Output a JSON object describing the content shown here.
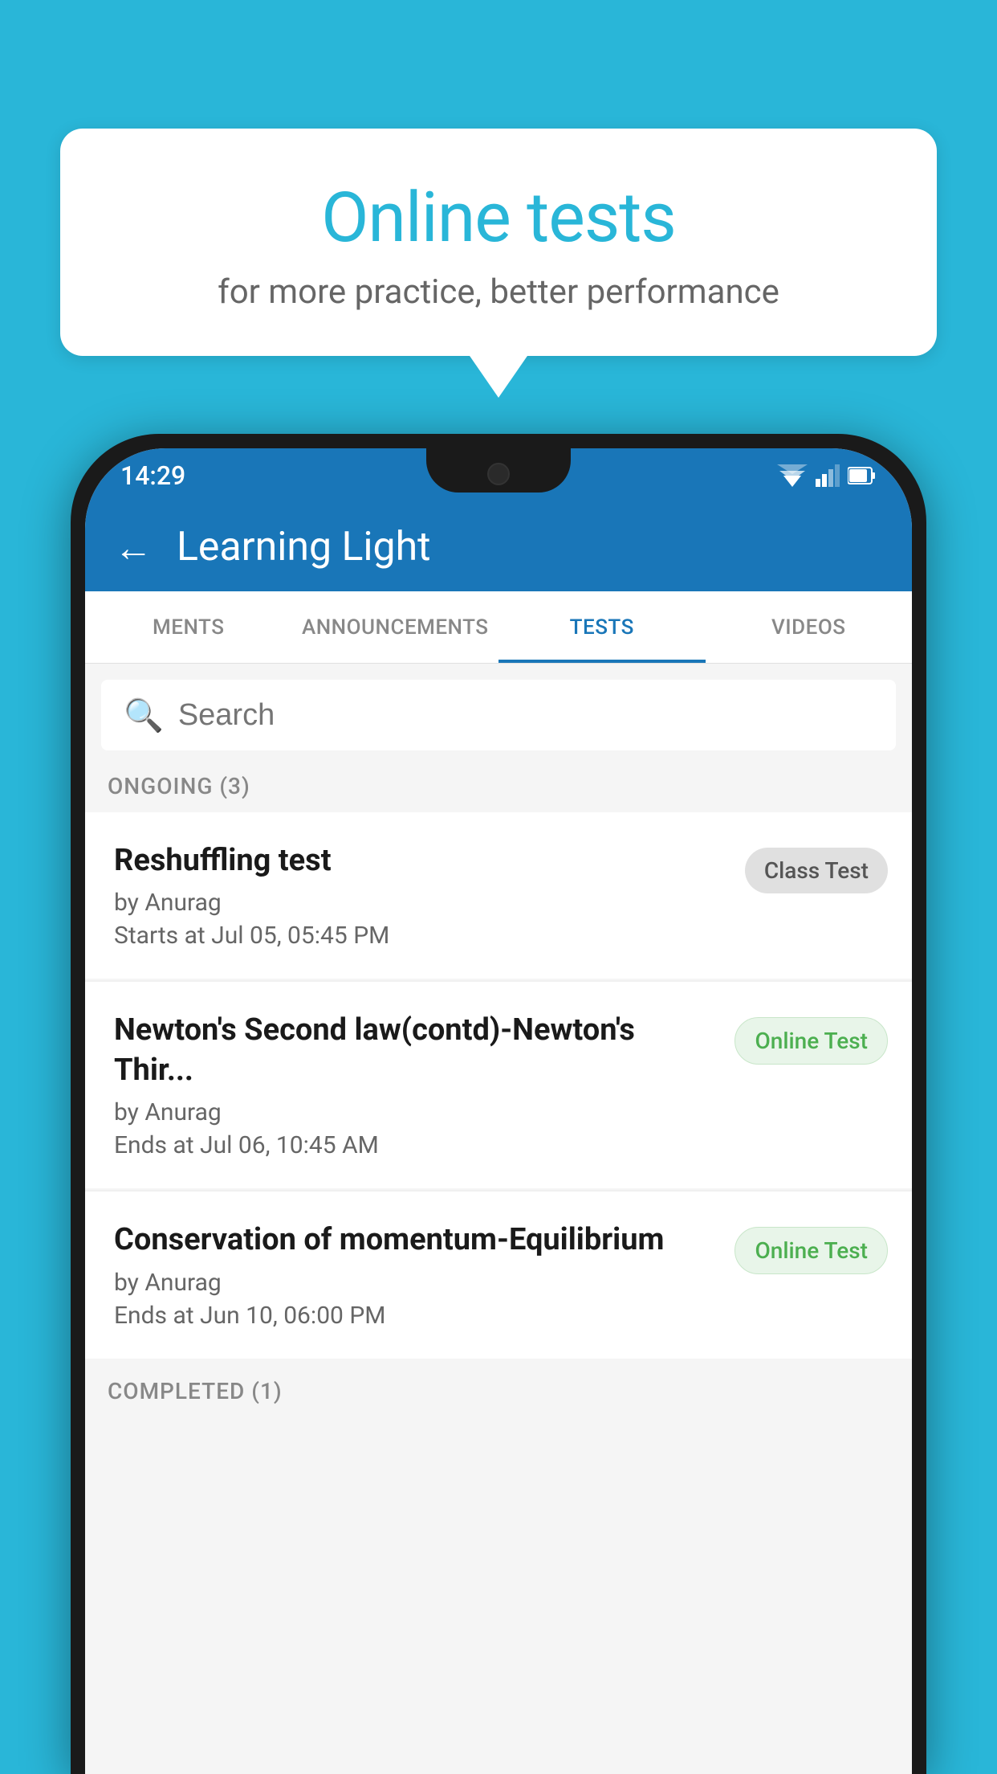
{
  "background_color": "#29B6D8",
  "bubble": {
    "title": "Online tests",
    "subtitle": "for more practice, better performance"
  },
  "phone": {
    "status_bar": {
      "time": "14:29"
    },
    "app_bar": {
      "back_label": "←",
      "title": "Learning Light"
    },
    "tabs": [
      {
        "label": "MENTS",
        "active": false
      },
      {
        "label": "ANNOUNCEMENTS",
        "active": false
      },
      {
        "label": "TESTS",
        "active": true
      },
      {
        "label": "VIDEOS",
        "active": false
      }
    ],
    "search": {
      "placeholder": "Search"
    },
    "ongoing_section": {
      "header": "ONGOING (3)",
      "tests": [
        {
          "title": "Reshuffling test",
          "by": "by Anurag",
          "date": "Starts at  Jul 05, 05:45 PM",
          "badge": "Class Test",
          "badge_type": "class"
        },
        {
          "title": "Newton's Second law(contd)-Newton's Thir...",
          "by": "by Anurag",
          "date": "Ends at  Jul 06, 10:45 AM",
          "badge": "Online Test",
          "badge_type": "online"
        },
        {
          "title": "Conservation of momentum-Equilibrium",
          "by": "by Anurag",
          "date": "Ends at  Jun 10, 06:00 PM",
          "badge": "Online Test",
          "badge_type": "online"
        }
      ]
    },
    "completed_section": {
      "header": "COMPLETED (1)"
    }
  }
}
